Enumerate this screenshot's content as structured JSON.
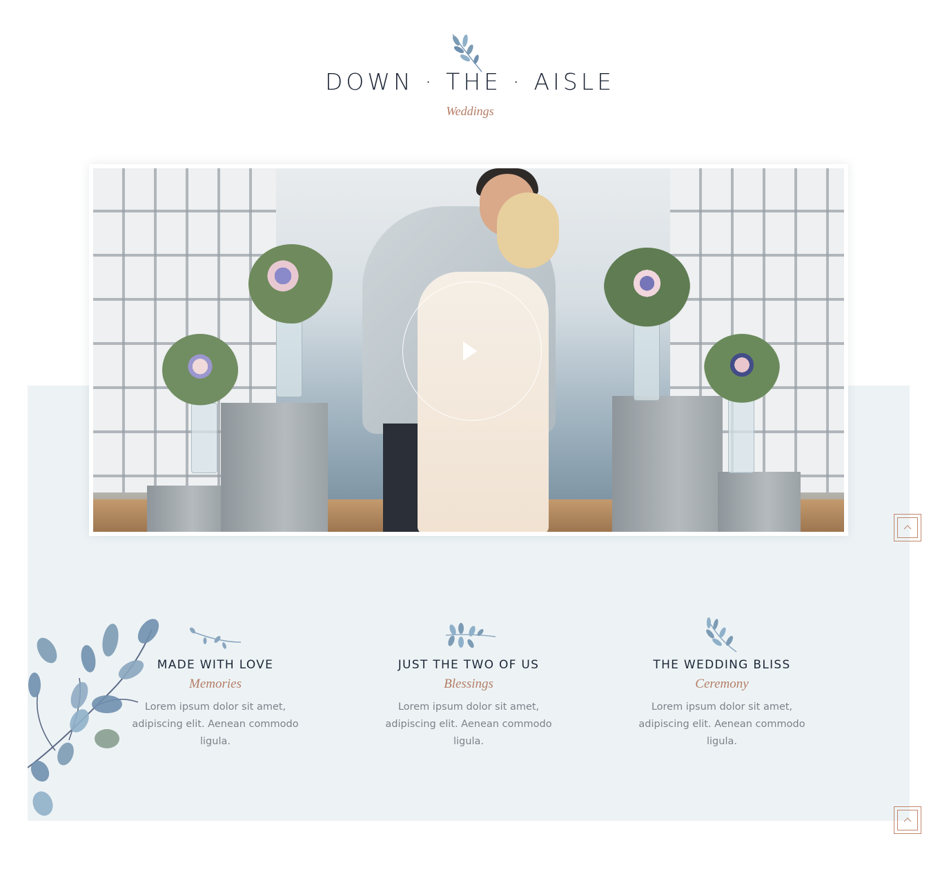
{
  "header": {
    "title": "DOWN · THE · AISLE",
    "subtitle": "Weddings"
  },
  "video": {
    "play_icon": "play-icon"
  },
  "features": [
    {
      "icon": "twig-icon",
      "title": "MADE WITH LOVE",
      "subtitle": "Memories",
      "text": "Lorem ipsum dolor sit amet, adipiscing elit. Aenean commodo ligula."
    },
    {
      "icon": "leaf-sprig-icon",
      "title": "JUST THE TWO OF US",
      "subtitle": "Blessings",
      "text": "Lorem ipsum dolor sit amet, adipiscing elit. Aenean commodo ligula."
    },
    {
      "icon": "leaf-branch-icon",
      "title": "THE WEDDING BLISS",
      "subtitle": "Ceremony",
      "text": "Lorem ipsum dolor sit amet, adipiscing elit. Aenean commodo ligula."
    }
  ],
  "colors": {
    "accent": "#b47d66",
    "heading": "#1d2636",
    "band": "#edf3f5",
    "leaf": "#7c9bb4"
  }
}
